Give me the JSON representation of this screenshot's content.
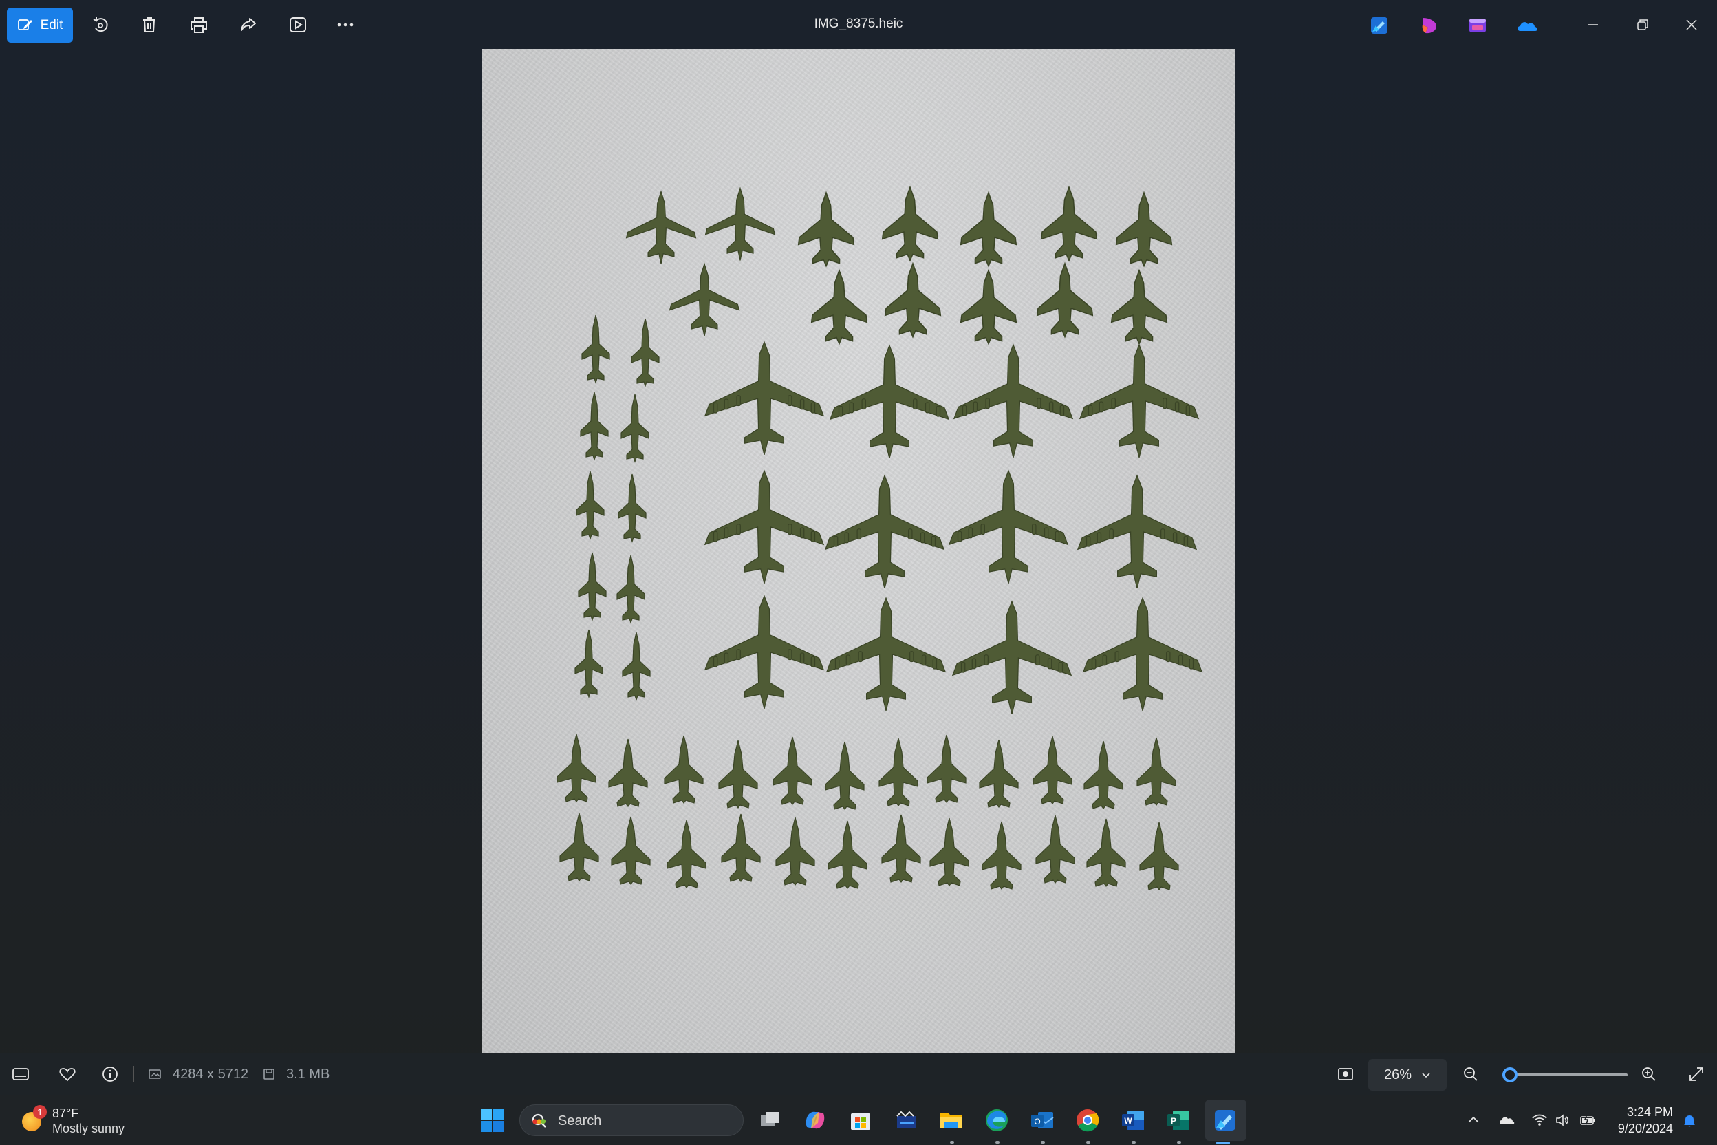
{
  "titlebar": {
    "edit_label": "Edit",
    "file_name": "IMG_8375.heic",
    "toolbar_icons": [
      "rotate-icon",
      "delete-icon",
      "print-icon",
      "share-icon",
      "slideshow-icon",
      "more-icon"
    ],
    "app_icons": [
      "photos-editor-icon",
      "clipchamp-icon",
      "designer-icon",
      "onedrive-icon"
    ]
  },
  "photo": {
    "description_visible": false
  },
  "infobar": {
    "dimensions": "4284 x 5712",
    "file_size": "3.1 MB",
    "zoom": "26%",
    "zoom_level_fraction": 0.04
  },
  "taskbar": {
    "weather_temp": "87°F",
    "weather_desc": "Mostly sunny",
    "weather_badge": "1",
    "search_label": "Search",
    "pinned_apps": [
      "start-icon",
      "task-view-icon",
      "copilot-icon",
      "store-icon",
      "app-icon",
      "file-explorer-icon",
      "edge-icon",
      "outlook-icon",
      "chrome-icon",
      "word-icon",
      "publisher-icon",
      "photos-icon"
    ],
    "time": "3:24 PM",
    "date": "9/20/2024"
  },
  "colors": {
    "accent": "#1a7fe8",
    "plane_green": "#4f5b35",
    "photo_paper": "#d2d3d4"
  }
}
